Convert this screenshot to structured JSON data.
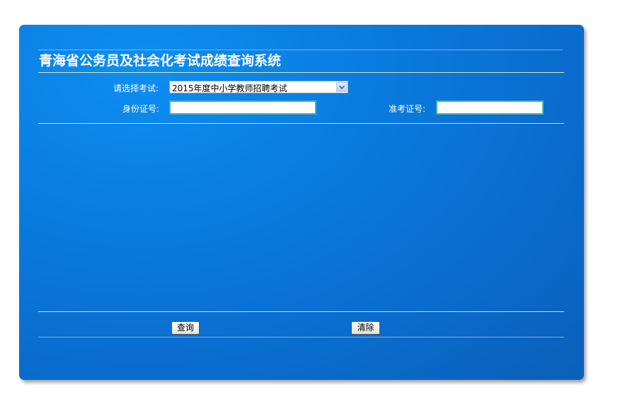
{
  "header": {
    "title": "青海省公务员及社会化考试成绩查询系统"
  },
  "form": {
    "exam_label": "请选择考试:",
    "exam_selected": "2015年度中小学教师招聘考试",
    "id_label": "身份证号:",
    "id_value": "",
    "ticket_label": "准考证号:",
    "ticket_value": ""
  },
  "buttons": {
    "query_label": "查询",
    "clear_label": "清除"
  },
  "icons": {
    "dropdown": "chevron-down-icon"
  },
  "colors": {
    "panel": "#0a7ce0",
    "divider": "#d7e6a2",
    "input_border": "#3fb3b5"
  }
}
